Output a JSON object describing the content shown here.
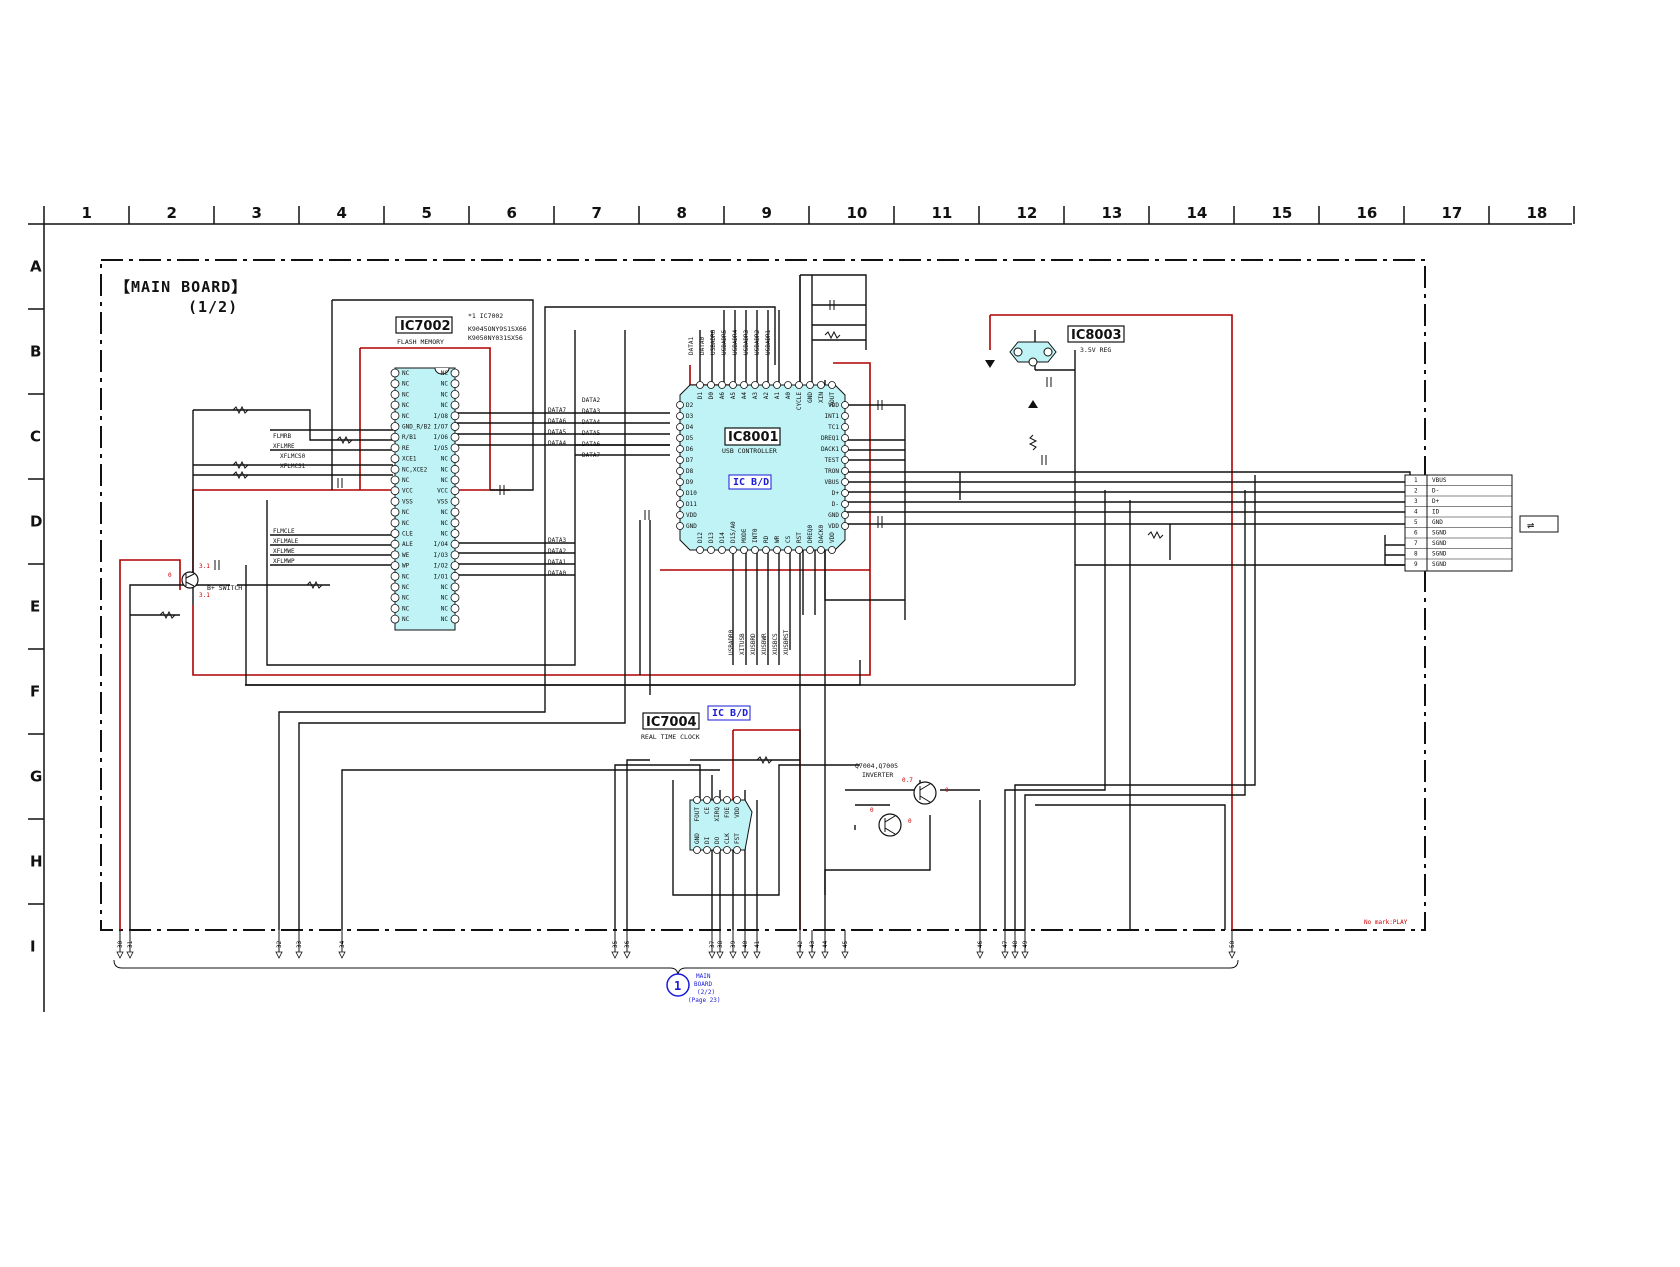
{
  "grid": {
    "columns": [
      "1",
      "2",
      "3",
      "4",
      "5",
      "6",
      "7",
      "8",
      "9",
      "10",
      "11",
      "12",
      "13",
      "14",
      "15",
      "16",
      "17",
      "18"
    ],
    "rows": [
      "A",
      "B",
      "C",
      "D",
      "E",
      "F",
      "G",
      "H",
      "I"
    ]
  },
  "board": {
    "title": "【MAIN BOARD】",
    "subtitle": "(1/2)",
    "note": "No mark:PLAY"
  },
  "ic7002": {
    "name": "IC7002",
    "function": "FLASH MEMORY",
    "note_line1": "*1 IC7002",
    "note_line2": "K9045ONY9S1SX66",
    "note_line3": "K9050NY031SX56",
    "left_pins": [
      "NC",
      "NC",
      "NC",
      "NC",
      "NC",
      "GND_R/B2",
      "R/B1",
      "RE",
      "XCE1",
      "NC,XCE2",
      "NC",
      "VCC",
      "VSS",
      "NC",
      "NC",
      "CLE",
      "ALE",
      "WE",
      "WP",
      "NC",
      "NC",
      "NC",
      "NC",
      "NC"
    ],
    "right_pins": [
      "NC",
      "NC",
      "NC",
      "NC",
      "I/O8",
      "I/O7",
      "I/O6",
      "I/O5",
      "NC",
      "NC",
      "NC",
      "VCC",
      "VSS",
      "NC",
      "NC",
      "NC",
      "I/O4",
      "I/O3",
      "I/O2",
      "I/O1",
      "NC",
      "NC",
      "NC",
      "NC"
    ]
  },
  "ic8001": {
    "name": "IC8001",
    "function": "USB CONTROLLER",
    "tag": "IC B/D",
    "left_pins": [
      "D2",
      "D3",
      "D4",
      "D5",
      "D6",
      "D7",
      "D8",
      "D9",
      "D10",
      "D11",
      "VDD",
      "GND"
    ],
    "right_pins": [
      "VDD",
      "INT1",
      "TC1",
      "DREQ1",
      "DACK1",
      "TEST",
      "TRON",
      "VBUS",
      "D+",
      "D-",
      "GND",
      "VDD"
    ],
    "top_pins": [
      "D1",
      "D0",
      "A6",
      "A5",
      "A4",
      "A3",
      "A2",
      "A1",
      "A0",
      "CYCLE",
      "GND",
      "XIN",
      "XOUT"
    ],
    "bottom_pins": [
      "D12",
      "D13",
      "D14",
      "D15/A0",
      "MODE",
      "INT0",
      "RD",
      "WR",
      "CS",
      "RST",
      "DREQ0",
      "DACK0",
      "VDD"
    ]
  },
  "ic8003": {
    "name": "IC8003",
    "function": "3.5V REG"
  },
  "ic7004": {
    "name": "IC7004",
    "function": "REAL TIME CLOCK",
    "tag": "IC B/D",
    "top_pins": [
      "FOUT",
      "CE",
      "XIRQ",
      "FOE",
      "VDD"
    ],
    "bottom_pins": [
      "GND",
      "DI",
      "DO",
      "CLK",
      "FST"
    ]
  },
  "transistors": {
    "q_switch": "B+ SWITCH",
    "q_inverter": "Q7004,Q7005",
    "q_inverter_func": "INVERTER"
  },
  "connector": {
    "pins": [
      {
        "num": "1",
        "name": "VBUS"
      },
      {
        "num": "2",
        "name": "D-"
      },
      {
        "num": "3",
        "name": "D+"
      },
      {
        "num": "4",
        "name": "ID"
      },
      {
        "num": "5",
        "name": "GND"
      },
      {
        "num": "6",
        "name": "SGND"
      },
      {
        "num": "7",
        "name": "SGND"
      },
      {
        "num": "8",
        "name": "SGND"
      },
      {
        "num": "9",
        "name": "SGND"
      }
    ]
  },
  "signals": {
    "left": [
      "FLMRB",
      "XFLMRE",
      "XFLMCS0",
      "XFLMCS1",
      "FLMCLE",
      "XFLMALE",
      "XFLMWE",
      "XFLMWP"
    ],
    "data_upper": [
      "DATA7",
      "DATA6",
      "DATA5",
      "DATA4"
    ],
    "data_upper_b": [
      "DATA2",
      "DATA3",
      "DATA4",
      "DATA5",
      "DATA6",
      "DATA7"
    ],
    "data_lower": [
      "DATA3",
      "DATA2",
      "DATA1",
      "DATA0"
    ],
    "top_bus": [
      "DATA1",
      "DATA0",
      "USBADR6",
      "USBADR5",
      "USBADR4",
      "USBADR3",
      "USBADR2",
      "USBADR1"
    ],
    "bottom_bus": [
      "USBADR0",
      "XITUSB",
      "XUSBRD",
      "XUSBWR",
      "XUSBCS",
      "XUSBRST"
    ]
  },
  "voltages": {
    "v31": "3.1",
    "v0": "0",
    "v07": "0.7"
  },
  "reference": {
    "circle": "1",
    "line1": "MAIN",
    "line2": "BOARD",
    "line3": "(2/2)",
    "line4": "(Page 23)"
  },
  "bottom_connector_pins": [
    "30",
    "31",
    "32",
    "33",
    "34",
    "35",
    "36",
    "37",
    "38",
    "39",
    "40",
    "41",
    "42",
    "43",
    "44",
    "45",
    "46",
    "47",
    "48",
    "49",
    "50"
  ],
  "colors": {
    "wire": "#111111",
    "red_trace": "#b00000",
    "ic_fill": "#bff3f5",
    "blue_label": "#1a1ad8"
  }
}
